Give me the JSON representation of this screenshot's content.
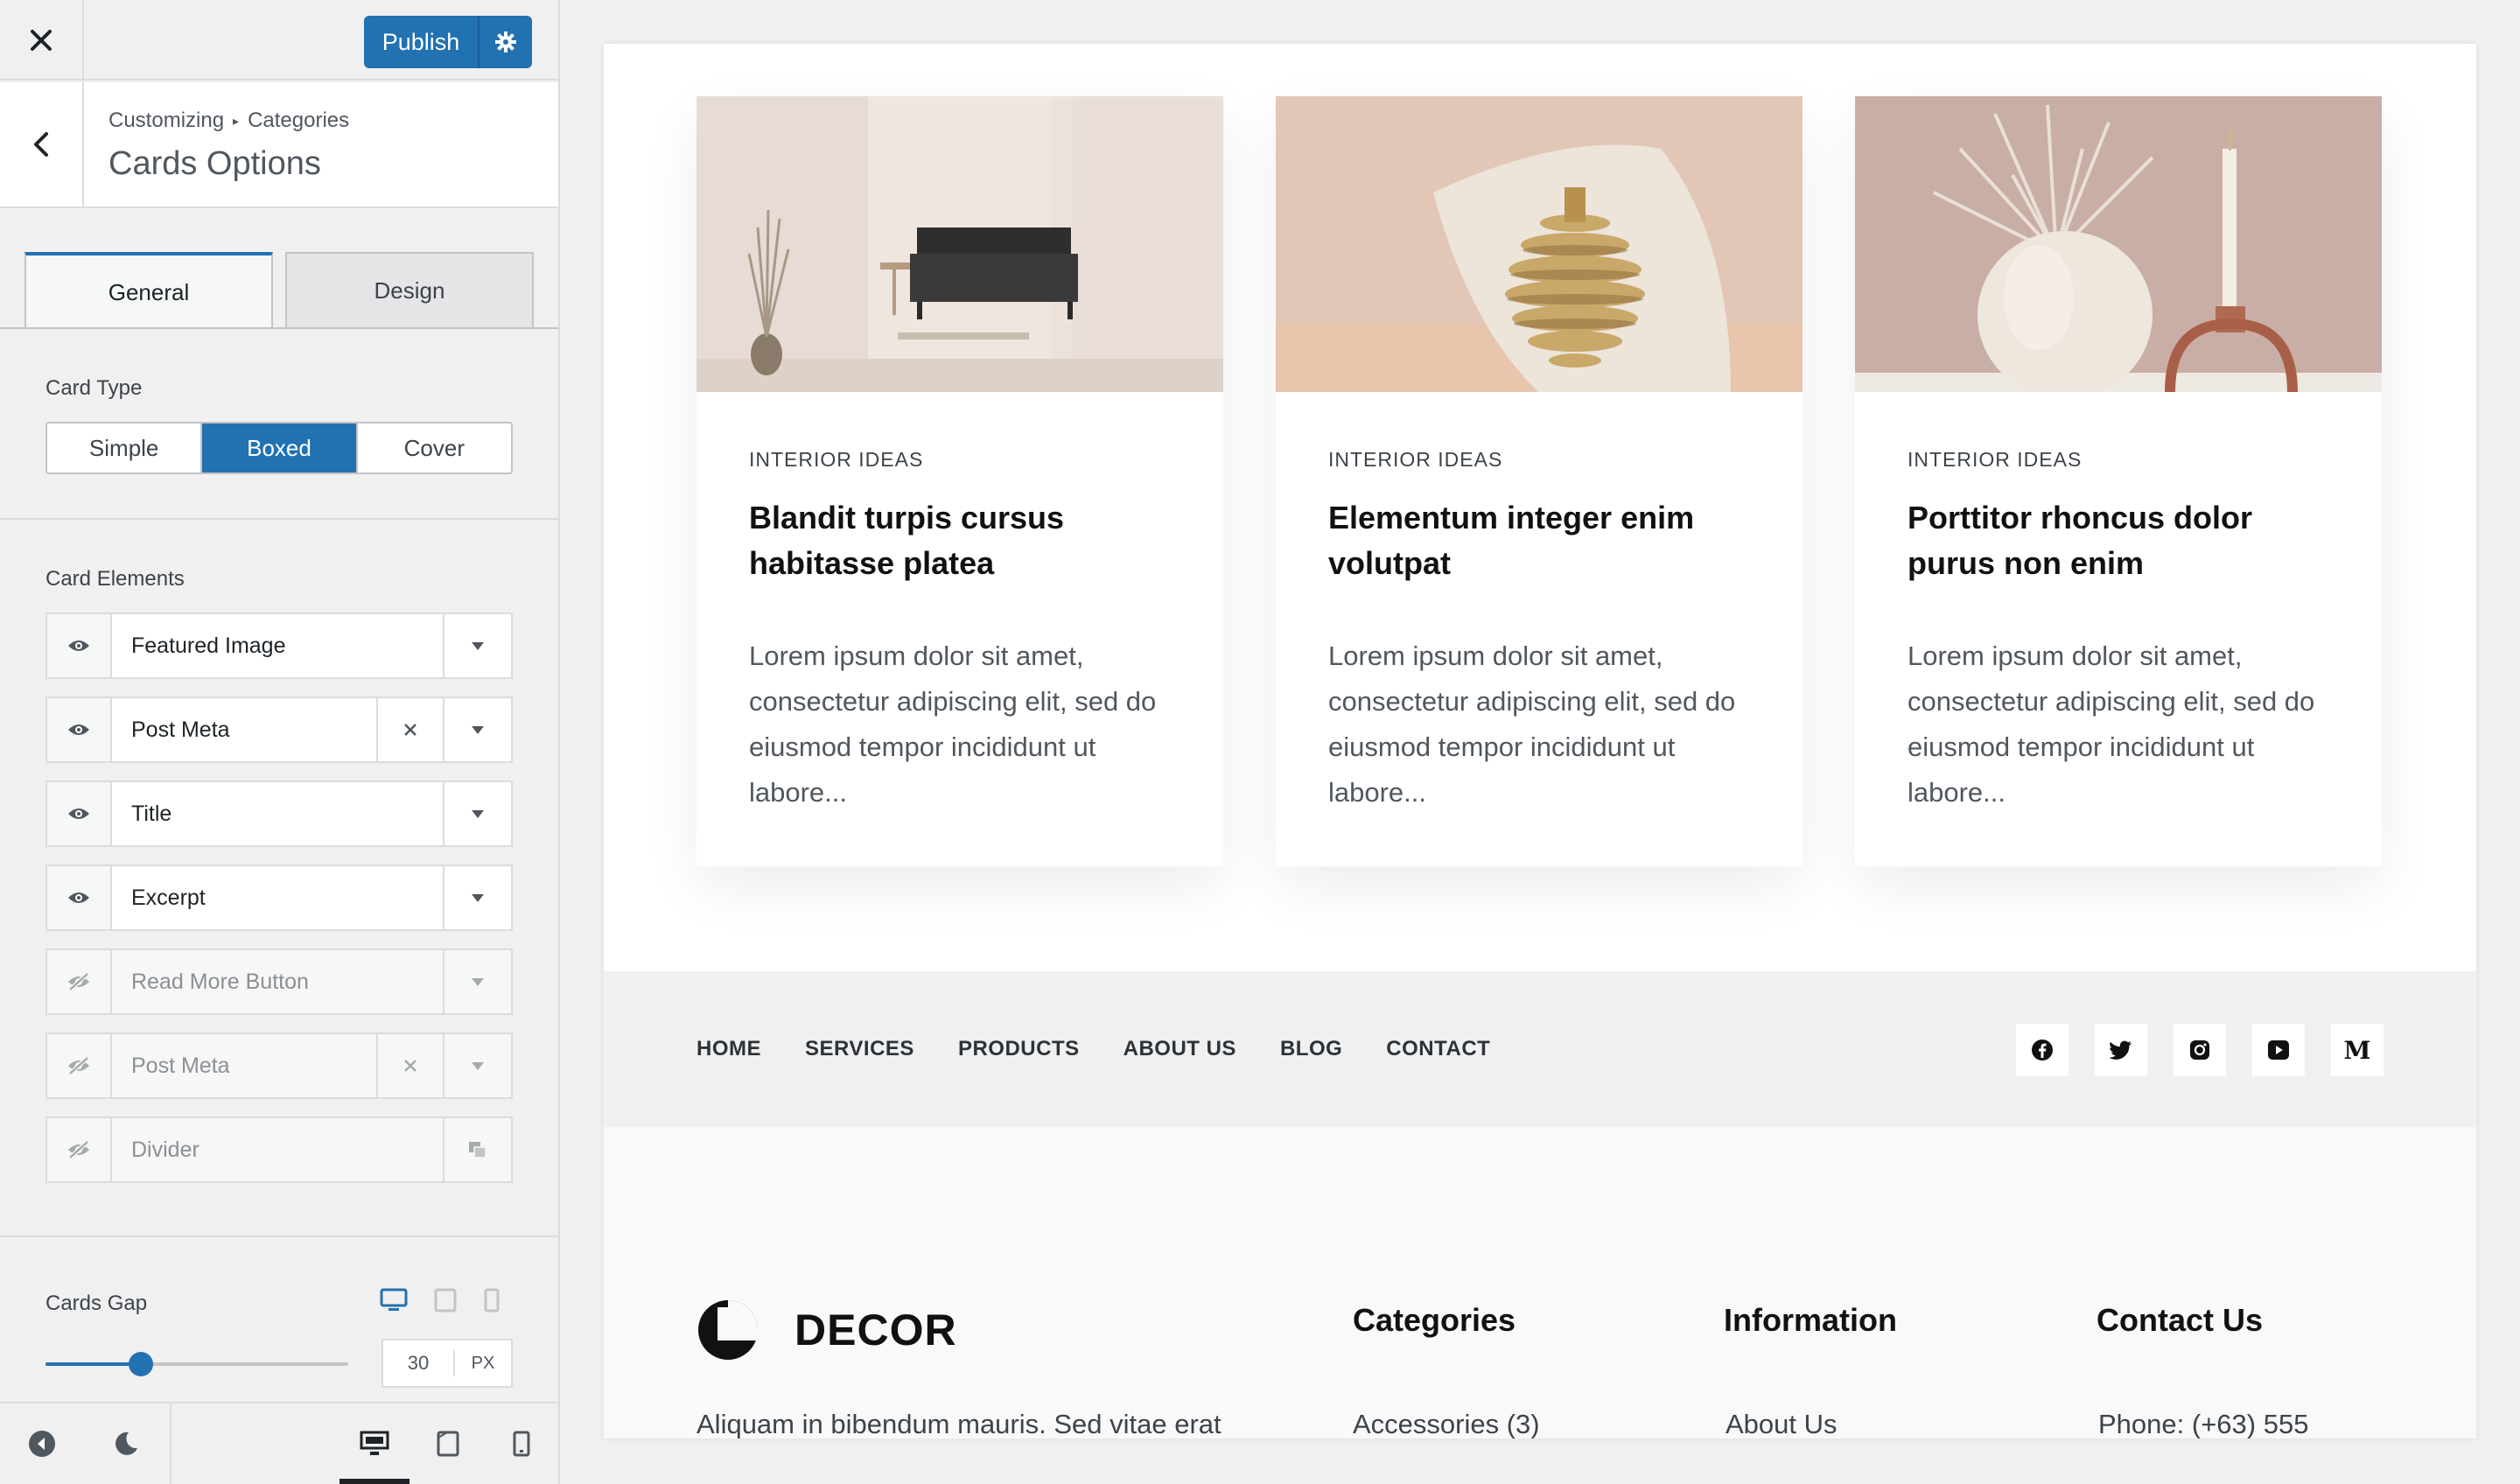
{
  "topbar": {
    "publish_label": "Publish"
  },
  "header": {
    "breadcrumb_root": "Customizing",
    "breadcrumb_separator": "▸",
    "breadcrumb_section": "Categories",
    "title": "Cards Options"
  },
  "tabs": [
    {
      "label": "General"
    },
    {
      "label": "Design"
    }
  ],
  "card_type": {
    "label": "Card Type",
    "options": [
      {
        "label": "Simple"
      },
      {
        "label": "Boxed"
      },
      {
        "label": "Cover"
      }
    ],
    "selected": "Boxed"
  },
  "card_elements": {
    "label": "Card Elements",
    "items": [
      {
        "label": "Featured Image",
        "visible": true,
        "removable": false
      },
      {
        "label": "Post Meta",
        "visible": true,
        "removable": true
      },
      {
        "label": "Title",
        "visible": true,
        "removable": false
      },
      {
        "label": "Excerpt",
        "visible": true,
        "removable": false
      },
      {
        "label": "Read More Button",
        "visible": false,
        "removable": false
      },
      {
        "label": "Post Meta",
        "visible": false,
        "removable": true
      },
      {
        "label": "Divider",
        "visible": false,
        "removable": false
      }
    ]
  },
  "cards_gap": {
    "label": "Cards Gap",
    "value": "30",
    "unit": "PX"
  },
  "preview": {
    "cards": [
      {
        "category": "INTERIOR IDEAS",
        "title": "Blandit turpis cursus habitasse platea",
        "excerpt": "Lorem ipsum dolor sit amet, consectetur adipiscing elit, sed do eiusmod tempor incididunt ut labore..."
      },
      {
        "category": "INTERIOR IDEAS",
        "title": "Elementum integer enim volutpat",
        "excerpt": "Lorem ipsum dolor sit amet, consectetur adipiscing elit, sed do eiusmod tempor incididunt ut labore..."
      },
      {
        "category": "INTERIOR IDEAS",
        "title": "Porttitor rhoncus dolor purus non enim",
        "excerpt": "Lorem ipsum dolor sit amet, consectetur adipiscing elit, sed do eiusmod tempor incididunt ut labore..."
      }
    ],
    "menu": [
      "HOME",
      "SERVICES",
      "PRODUCTS",
      "ABOUT US",
      "BLOG",
      "CONTACT"
    ],
    "socials": [
      "facebook-icon",
      "twitter-icon",
      "instagram-icon",
      "youtube-icon",
      "medium-icon"
    ],
    "medium_letter": "M",
    "footer": {
      "logo_text": "DECOR",
      "description": "Aliquam in bibendum mauris. Sed vitae erat",
      "columns": [
        {
          "heading": "Categories",
          "first_item": "Accessories (3)"
        },
        {
          "heading": "Information",
          "first_item": "About Us"
        },
        {
          "heading": "Contact Us",
          "first_item": "Phone: (+63) 555"
        }
      ]
    }
  },
  "colors": {
    "accent": "#2271b1"
  }
}
